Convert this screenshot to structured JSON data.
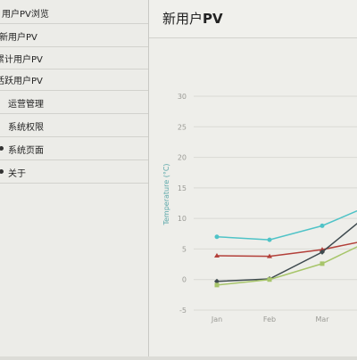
{
  "sidebar": {
    "items": [
      {
        "label": "用户PV浏览"
      },
      {
        "label": "新用户PV"
      },
      {
        "label": "累计用户PV"
      },
      {
        "label": "活跃用户PV"
      },
      {
        "label": "运营管理"
      },
      {
        "label": "系统权限"
      },
      {
        "label": "系统页面"
      },
      {
        "label": "关于"
      }
    ]
  },
  "header": {
    "title_prefix": "新用户",
    "title_suffix": "PV"
  },
  "colors": {
    "series1": "#4fc3c7",
    "series2": "#b3403a",
    "series3": "#3e4a4f",
    "series4": "#a7c56a",
    "grid": "#d9d9d4",
    "axis_text": "#9a9a95"
  },
  "chart_data": {
    "type": "line",
    "ylabel": "Temperature (°C)",
    "categories": [
      "Jan",
      "Feb",
      "Mar"
    ],
    "y_ticks": [
      30,
      25,
      20,
      15,
      10,
      5,
      0,
      -5
    ],
    "ylim": [
      -5,
      30
    ],
    "grid": true,
    "series": [
      {
        "values": [
          7.0,
          6.5,
          8.8
        ],
        "marker": "circle"
      },
      {
        "values": [
          3.9,
          3.8,
          4.9
        ],
        "marker": "triangle"
      },
      {
        "values": [
          -0.3,
          0.1,
          4.5
        ],
        "marker": "diamond"
      },
      {
        "values": [
          -0.9,
          0.0,
          2.6
        ],
        "marker": "square"
      }
    ]
  }
}
